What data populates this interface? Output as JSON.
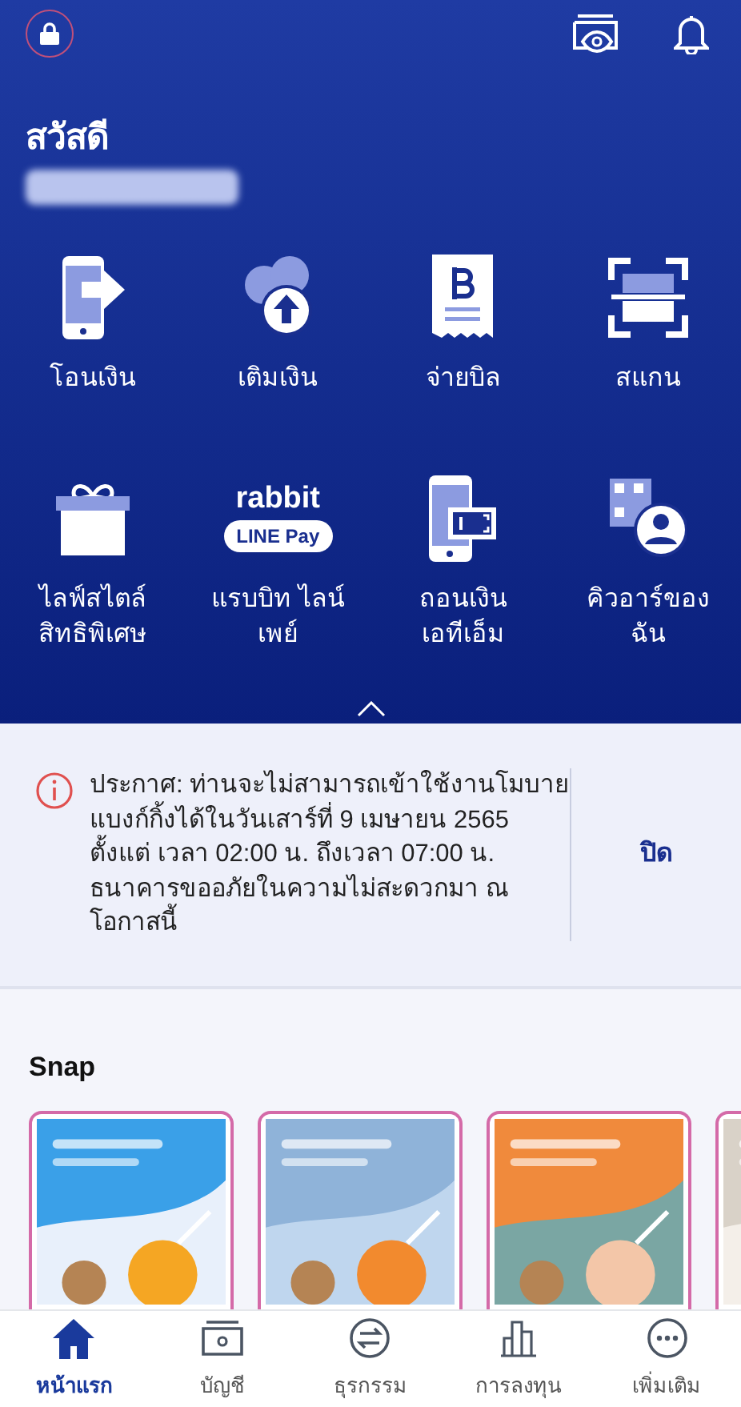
{
  "header": {
    "greeting": "สวัสดี"
  },
  "menu": [
    {
      "kind": "transfer",
      "lines": [
        "โอนเงิน"
      ]
    },
    {
      "kind": "topup",
      "lines": [
        "เติมเงิน"
      ]
    },
    {
      "kind": "bill",
      "lines": [
        "จ่ายบิล"
      ]
    },
    {
      "kind": "scan",
      "lines": [
        "สแกน"
      ]
    },
    {
      "kind": "gift",
      "lines": [
        "ไลฟ์สไตล์",
        "สิทธิพิเศษ"
      ]
    },
    {
      "kind": "rabbit",
      "logo": [
        "rabbit",
        "LINE Pay"
      ],
      "lines": [
        "แรบบิท ไลน์",
        "เพย์"
      ]
    },
    {
      "kind": "atm",
      "lines": [
        "ถอนเงิน",
        "เอทีเอ็ม"
      ]
    },
    {
      "kind": "qr",
      "lines": [
        "คิวอาร์ของ",
        "ฉัน"
      ]
    }
  ],
  "notice": {
    "lines": [
      "ประกาศ: ท่านจะไม่สามารถเข้าใช้งานโมบาย",
      "แบงก์กิ้งได้ในวันเสาร์ที่ 9 เมษายน 2565",
      "ตั้งแต่ เวลา 02:00 น. ถึงเวลา 07:00 น.",
      "ธนาคารขออภัยในความไม่สะดวกมา ณ",
      "โอกาสนี้"
    ],
    "close": "ปิด"
  },
  "snap": {
    "title": "Snap"
  },
  "bottom_nav": [
    {
      "kind": "home",
      "label": "หน้าแรก",
      "selected": true
    },
    {
      "kind": "account",
      "label": "บัญชี",
      "selected": false
    },
    {
      "kind": "transaction",
      "label": "ธุรกรรม",
      "selected": false
    },
    {
      "kind": "invest",
      "label": "การลงทุน",
      "selected": false
    },
    {
      "kind": "more",
      "label": "เพิ่มเติม",
      "selected": false
    }
  ]
}
